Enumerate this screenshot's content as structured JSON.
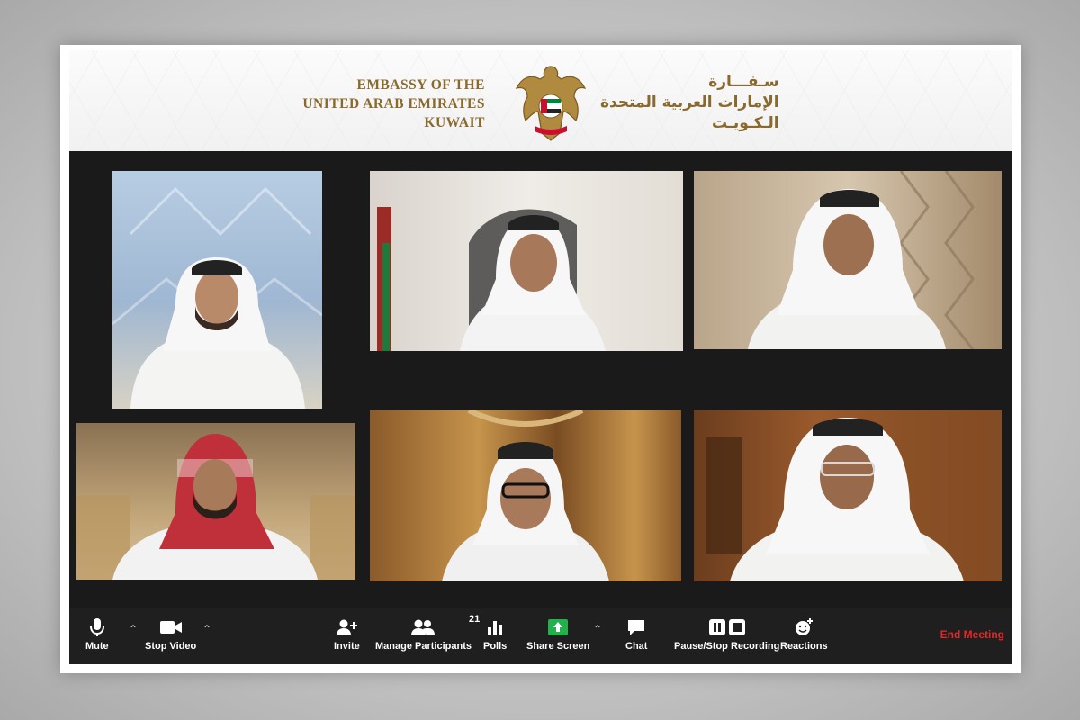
{
  "banner": {
    "en_line1": "EMBASSY OF THE",
    "en_line2": "UNITED ARAB EMIRATES",
    "en_line3": "KUWAIT",
    "ar_line1": "سـفـــارة",
    "ar_line2": "الإمارات العربية المتحدة",
    "ar_line3": "الـكـويـت",
    "emblem_icon": "falcon-emblem-icon",
    "gold": "#8a6a2c"
  },
  "toolbar": {
    "mute": "Mute",
    "stop_video": "Stop Video",
    "invite": "Invite",
    "manage_participants": "Manage Participants",
    "participant_count": "21",
    "polls": "Polls",
    "share_screen": "Share Screen",
    "chat": "Chat",
    "pause_stop_recording": "Pause/Stop Recording",
    "reactions": "Reactions",
    "end_meeting": "End Meeting",
    "share_color": "#22b14c",
    "end_color": "#e02828"
  }
}
